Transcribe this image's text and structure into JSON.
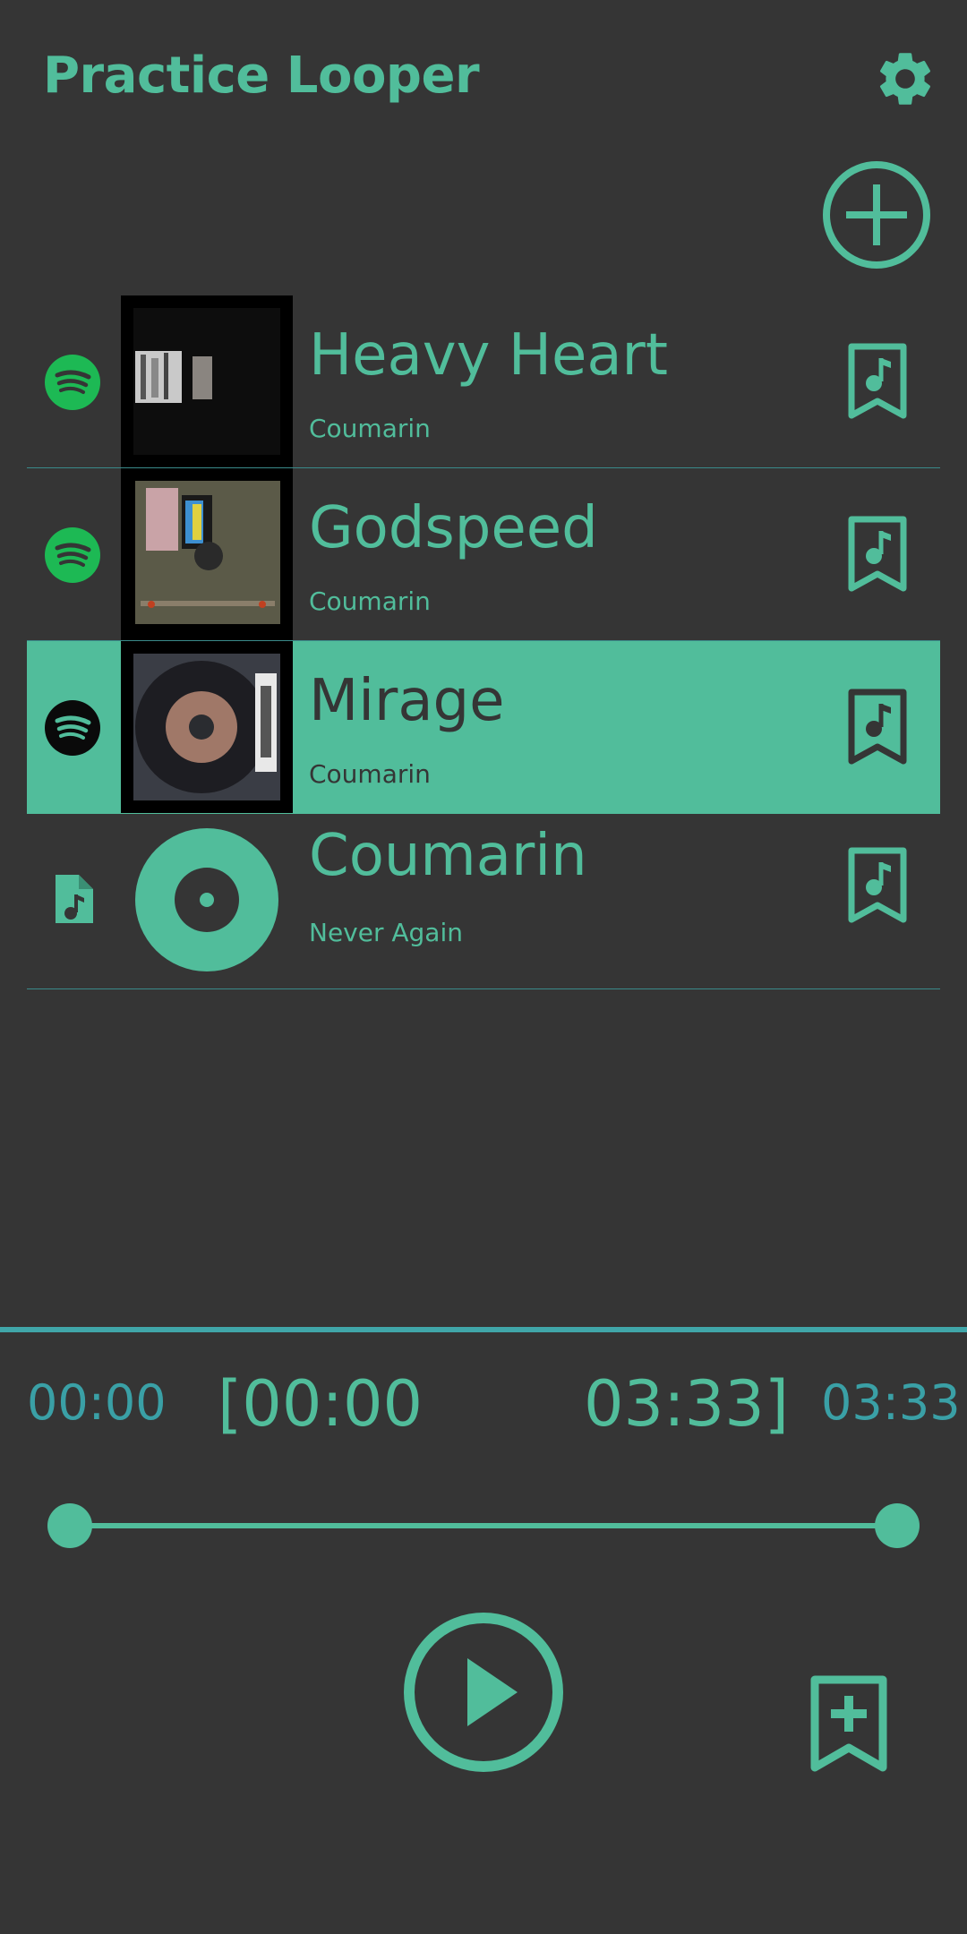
{
  "app": {
    "title": "Practice Looper"
  },
  "header": {
    "settings_icon": "gear-icon",
    "add_icon": "plus-circle-icon"
  },
  "colors": {
    "background": "#353535",
    "accent": "#51bd9b",
    "time_secondary": "#3aa0a6",
    "spotify_green": "#1db954"
  },
  "tracks": [
    {
      "name": "Heavy Heart",
      "artist": "Coumarin",
      "source": "spotify",
      "selected": false
    },
    {
      "name": "Godspeed",
      "artist": "Coumarin",
      "source": "spotify",
      "selected": false
    },
    {
      "name": "Mirage",
      "artist": "Coumarin",
      "source": "spotify",
      "selected": true
    },
    {
      "name": "Coumarin",
      "artist": "Never Again",
      "source": "local-file",
      "selected": false
    }
  ],
  "player": {
    "current_time": "00:00",
    "loop_start": "[00:00",
    "loop_end": "03:33]",
    "total_time": "03:33",
    "loop_range_fraction": [
      0,
      1
    ],
    "play_icon": "play-circle-icon",
    "add_bookmark_icon": "bookmark-add-icon"
  }
}
